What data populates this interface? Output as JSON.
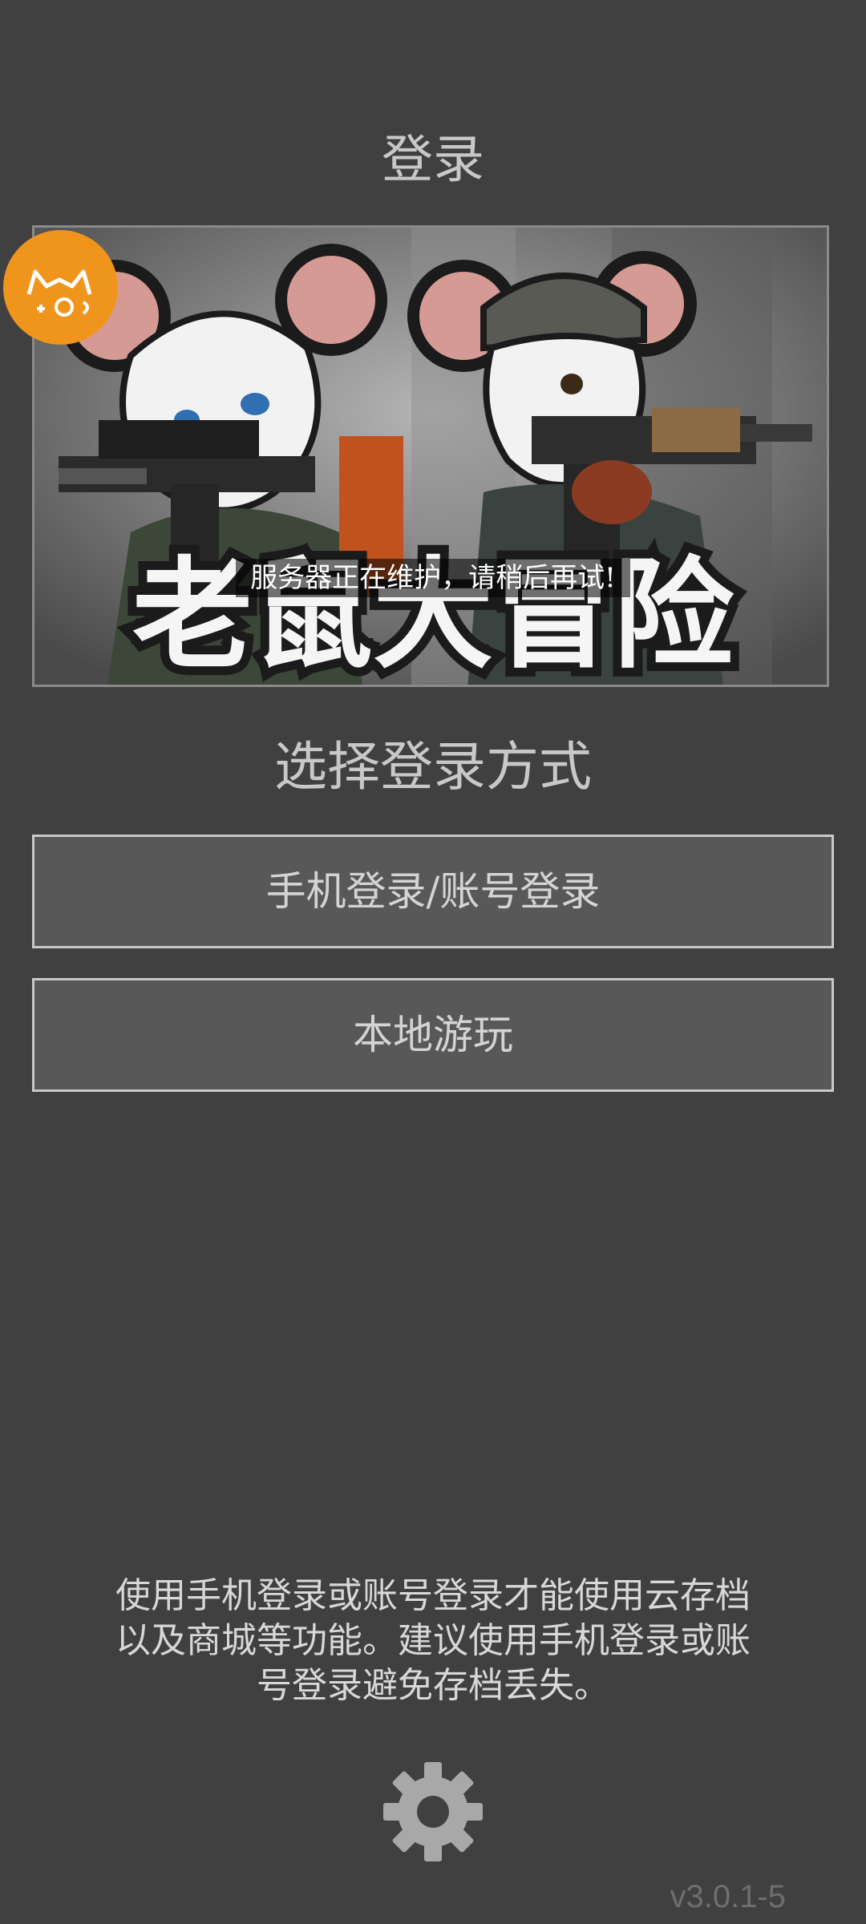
{
  "header": {
    "title": "登录"
  },
  "banner": {
    "game_title": "老鼠大冒险",
    "maintenance_text": "服务器正在维护，请稍后再试!",
    "badge_icon": "cat-logo-icon"
  },
  "login": {
    "subtitle": "选择登录方式",
    "phone_button_label": "手机登录/账号登录",
    "local_button_label": "本地游玩"
  },
  "notice": {
    "lines": [
      "使用手机登录或账号登录才能使用云存档",
      "以及商城等功能。建议使用手机登录或账",
      "号登录避免存档丢失。"
    ]
  },
  "footer": {
    "settings_icon": "gear-icon",
    "version": "v3.0.1-5"
  },
  "colors": {
    "background": "#404040",
    "button_fill": "#585858",
    "button_border": "#c8c8c8",
    "badge": "#f0951c"
  }
}
